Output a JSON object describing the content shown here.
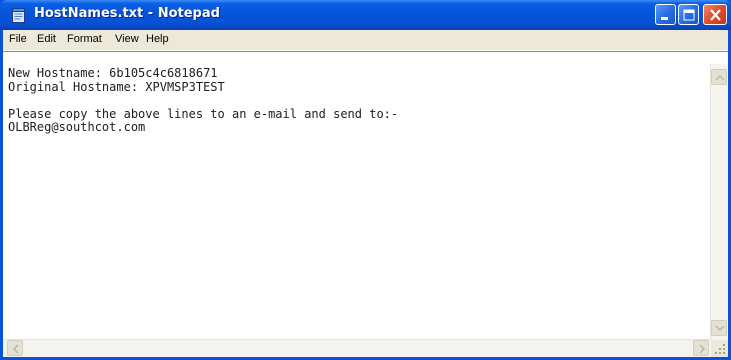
{
  "window": {
    "title": "HostNames.txt - Notepad"
  },
  "menu": {
    "items": [
      "File",
      "Edit",
      "Format",
      "View",
      "Help"
    ]
  },
  "document": {
    "lines": [
      "New Hostname: 6b105c4c6818671",
      "Original Hostname: XPVMSP3TEST",
      "",
      "Please copy the above lines to an e-mail and send to:-",
      "OLBReg@southcot.com"
    ]
  },
  "icons": {
    "app": "notepad-icon",
    "minimize": "minimize-icon",
    "maximize": "maximize-icon",
    "close": "close-icon"
  },
  "colors": {
    "titlebar": "#0654da",
    "close_button": "#dd4c2c",
    "menubar": "#ece9d8",
    "text": "#202020"
  }
}
